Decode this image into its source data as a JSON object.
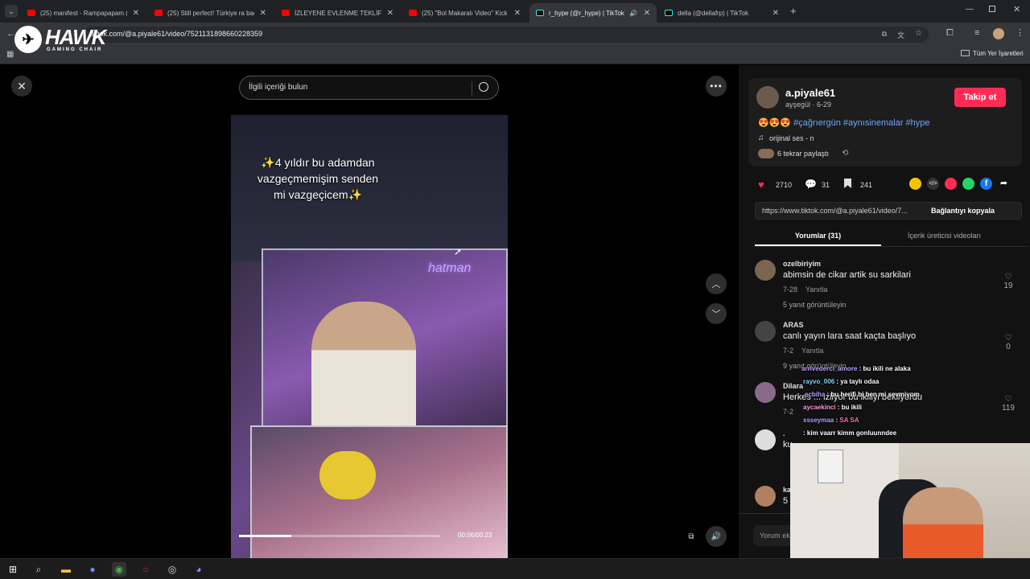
{
  "browser": {
    "tabs": [
      {
        "title": "(25) manifest - Rampapapam (/",
        "icon": "youtube-icon",
        "active": false
      },
      {
        "title": "(25) Still perfect! Türkiye ra baq",
        "icon": "youtube-icon",
        "active": false
      },
      {
        "title": "İZLEYENE EVLENME TEKLİFİ ED",
        "icon": "youtube-icon",
        "active": false
      },
      {
        "title": "(25) \"Bol Makaralı Video\" Kick 2",
        "icon": "youtube-icon",
        "active": false
      },
      {
        "title": "r_hype (@r_hype) | TikTok",
        "icon": "tiktok-icon",
        "active": true
      },
      {
        "title": "della (@dellafrp) | TikTok",
        "icon": "tiktok-icon",
        "active": false
      }
    ],
    "url": "tiktok.com/@a.piyale61/video/7521131898660228359",
    "bookmarks_label": "Tüm Yer İşaretleri"
  },
  "overlay_logo": {
    "brand": "HAWK",
    "sub": "GAMING CHAIR"
  },
  "search": {
    "placeholder": "İlgili içeriği bulun"
  },
  "video": {
    "caption_line1": "✨4 yıldır bu adamdan",
    "caption_line2": "vazgeçmemişim senden",
    "caption_line3": "mi vazgeçicem✨",
    "time": "00:06/00:23",
    "progress": 0.26
  },
  "author": {
    "username": "a.piyale61",
    "subline": "ayşegül · 6-29",
    "follow_label": "Takip et",
    "description_emojis": "😍😍😍",
    "hashtags": "#çağrıergün #aynısinemalar #hype",
    "sound": "orijinal ses - n",
    "reposts": "6 tekrar paylaştı"
  },
  "stats": {
    "likes": "2710",
    "comments": "31",
    "saves": "241"
  },
  "share": {
    "link": "https://www.tiktok.com/@a.piyale61/video/7...",
    "copy_label": "Bağlantıyı kopyala"
  },
  "tabs": {
    "comments": "Yorumlar (31)",
    "creator_videos": "İçerik üreticisi videoları"
  },
  "comments": [
    {
      "name": "ozelbiriyim",
      "text": "abimsin de cikar artik su sarkilari",
      "date": "7-28",
      "reply": "Yanıtla",
      "likes": "19",
      "replies": "5 yanıt görüntüleyin"
    },
    {
      "name": "ARAS",
      "text": "canlı yayın lara saat kaçta başlıyo",
      "date": "7-2",
      "reply": "Yanıtla",
      "likes": "0",
      "replies": "9 yanıt görüntüleyin"
    },
    {
      "name": "Dilara",
      "text": "Herkes ... izliyor bu ikiliyi bekliyordu",
      "date": "7-2",
      "reply": "",
      "likes": "119",
      "replies": ""
    },
    {
      "name": ".",
      "text": "ku...",
      "date": "",
      "reply": "",
      "likes": "",
      "replies": ""
    },
    {
      "name": "ka",
      "text": "5",
      "date": "",
      "reply": "",
      "likes": "",
      "replies": ""
    }
  ],
  "comment_input": {
    "placeholder": "Yorum ek"
  },
  "stream_chat": [
    {
      "user": "arrivederci_amore",
      "msg": "bu ikili ne alaka"
    },
    {
      "user": "rayvo_006",
      "msg": "ya taylı odaa"
    },
    {
      "user": "ecbiha",
      "msg": "bu herifi bi ben mi sevmiyom"
    },
    {
      "user": "aycaekinci",
      "msg": "bu ikili"
    },
    {
      "user": "ssseymaa",
      "msg": "SA SA"
    },
    {
      "user": "",
      "msg": "kim vaarr kimm gonluunndee"
    }
  ],
  "colors": {
    "accent": "#fe2c55",
    "link": "#6ea8ff",
    "panel": "#121212"
  }
}
